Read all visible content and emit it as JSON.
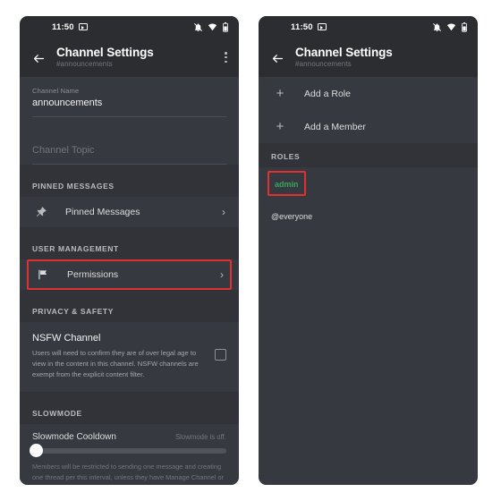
{
  "status_bar": {
    "time": "11:50",
    "cast_icon": "cast-icon",
    "icons": [
      "notifications-muted-icon",
      "wifi-icon",
      "battery-icon"
    ]
  },
  "header": {
    "back_icon": "back-arrow-icon",
    "title": "Channel Settings",
    "subtitle": "#announcements",
    "overflow_icon": "overflow-menu-icon"
  },
  "left_panel": {
    "channel_name": {
      "label": "Channel Name",
      "value": "announcements"
    },
    "channel_topic": {
      "placeholder": "Channel Topic"
    },
    "pinned_section": {
      "header": "PINNED MESSAGES",
      "row_label": "Pinned Messages",
      "icon": "pin-icon",
      "chevron": "›"
    },
    "user_management_section": {
      "header": "USER MANAGEMENT",
      "row_label": "Permissions",
      "icon": "flag-icon",
      "chevron": "›",
      "highlight_color": "#e03131"
    },
    "privacy_section": {
      "header": "PRIVACY & SAFETY",
      "nsfw_title": "NSFW Channel",
      "nsfw_description": "Users will need to confirm they are of over legal age to view in the content in this channel. NSFW channels are exempt from the explicit content filter.",
      "checkbox_state": "unchecked"
    },
    "slowmode_section": {
      "header": "SLOWMODE",
      "row_label": "Slowmode Cooldown",
      "status": "Slowmode is off.",
      "slider_value": 0,
      "description": "Members will be restricted to sending one message and creating one thread per this interval, unless they have Manage Channel or Manage Messages permissions."
    }
  },
  "right_panel": {
    "add_role": {
      "icon": "plus-icon",
      "label": "Add a Role"
    },
    "add_member": {
      "icon": "plus-icon",
      "label": "Add a Member"
    },
    "roles_section": {
      "header": "ROLES",
      "roles": [
        {
          "name": "admin",
          "color": "#3ba55d",
          "highlighted": true
        },
        {
          "name": "@everyone",
          "color": "#dcddde",
          "highlighted": false
        }
      ]
    }
  }
}
